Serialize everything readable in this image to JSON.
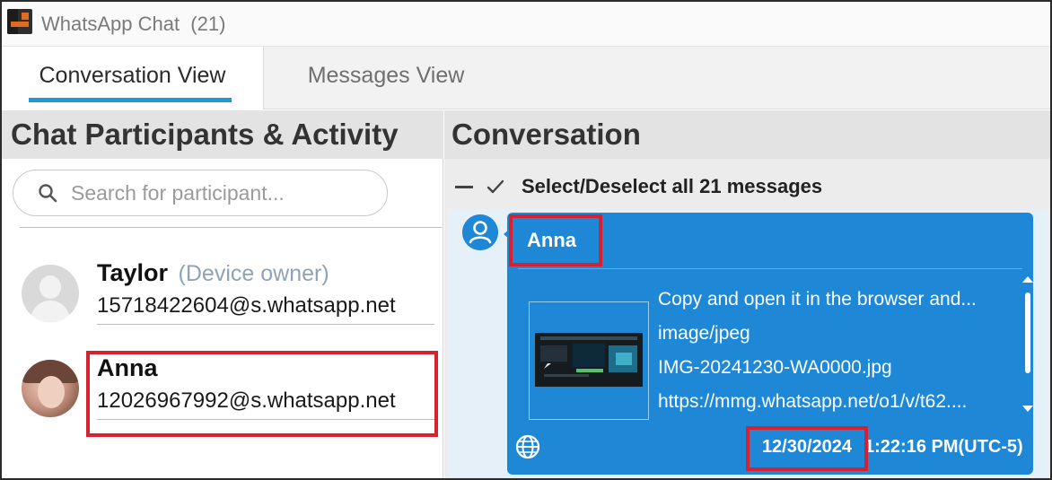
{
  "window": {
    "title": "WhatsApp Chat  (21)"
  },
  "tabs": [
    {
      "label": "Conversation View",
      "active": true
    },
    {
      "label": "Messages View",
      "active": false
    }
  ],
  "left_panel": {
    "heading": "Chat Participants & Activity",
    "search": {
      "placeholder": "Search for participant...",
      "value": ""
    },
    "participants": [
      {
        "name": "Taylor",
        "tag": "(Device owner)",
        "id": "15718422604@s.whatsapp.net"
      },
      {
        "name": "Anna",
        "tag": "",
        "id": "12026967992@s.whatsapp.net"
      }
    ]
  },
  "right_panel": {
    "heading": "Conversation",
    "select_all_label": "Select/Deselect all 21 messages",
    "message": {
      "sender": "Anna",
      "attachment_lines": [
        "Copy and open it in the browser and...",
        "image/jpeg",
        "IMG-20241230-WA0000.jpg",
        "https://mmg.whatsapp.net/o1/v/t62...."
      ],
      "date": "12/30/2024",
      "time": "1:22:16 PM(UTC-5)"
    }
  },
  "colors": {
    "accent_tab": "#1e9ad6",
    "bubble": "#1e88d6",
    "highlight": "#d8202e"
  },
  "icons": {
    "app": "app-icon",
    "search": "search-icon",
    "select_toggle": "checkmark-icon",
    "sender": "user-avatar-icon",
    "source": "globe-icon"
  }
}
